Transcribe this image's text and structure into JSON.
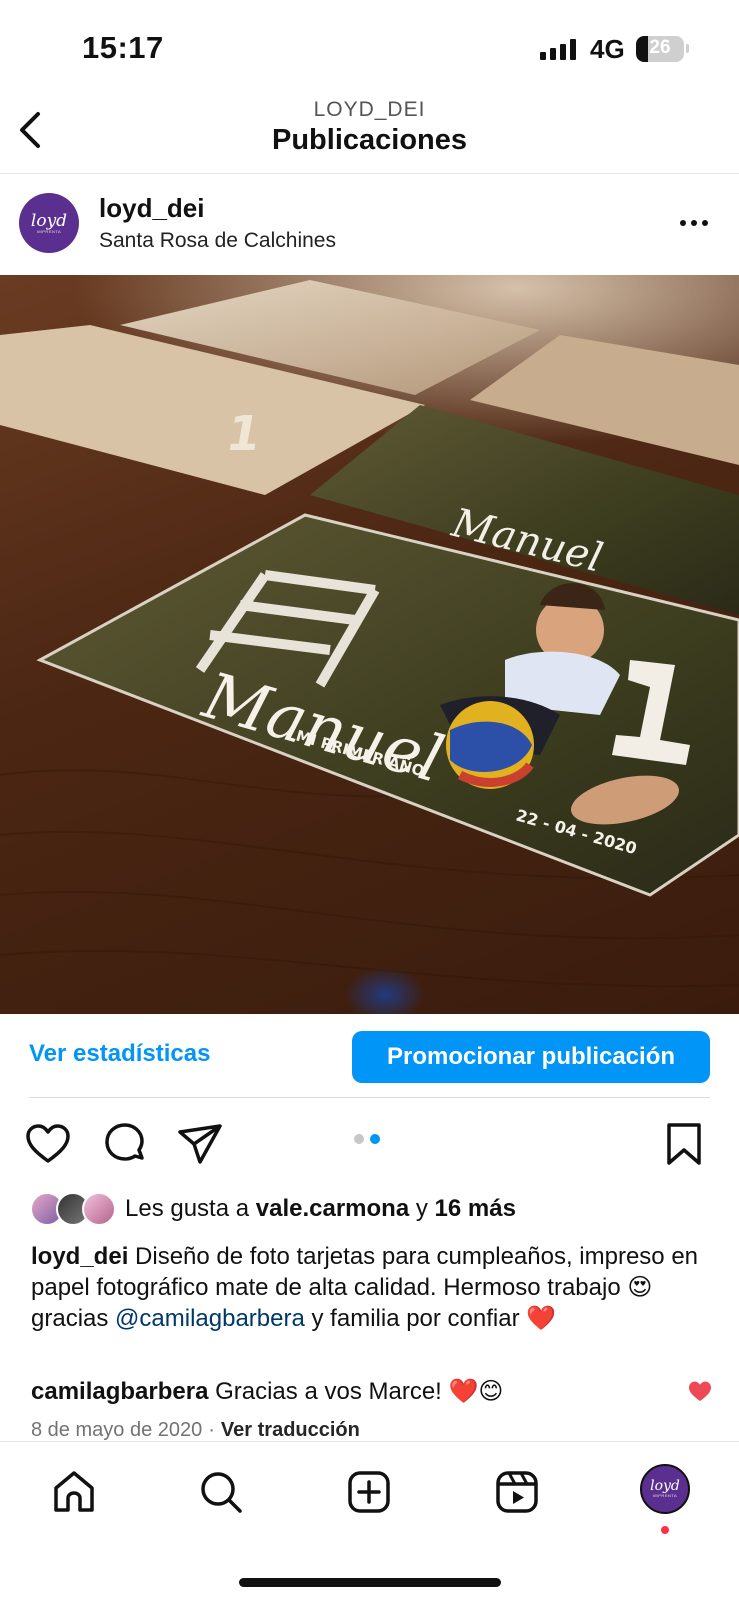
{
  "status_bar": {
    "time": "15:17",
    "network": "4G",
    "battery": "26",
    "battery_level": 0.26
  },
  "header": {
    "subtitle": "LOYD_DEI",
    "title": "Publicaciones"
  },
  "post": {
    "avatar_logo": "loyd",
    "avatar_sub": "IMPRENTA",
    "username": "loyd_dei",
    "location": "Santa Rosa de Calchines",
    "image_text": {
      "name": "Manuel",
      "tagline": "MI PRIMER AÑO",
      "date": "22 - 04 - 2020",
      "number": "1"
    },
    "stats_link": "Ver estadísticas",
    "promote_button": "Promocionar publicación",
    "carousel": {
      "count": 2,
      "active_index": 1
    },
    "likes": {
      "prefix": "Les gusta a",
      "user": "vale.carmona",
      "joiner": "y",
      "others": "16 más"
    },
    "caption": {
      "user": "loyd_dei",
      "text_1": "Diseño de foto tarjetas para cumpleaños, impreso en papel fotográfico mate de alta calidad. Hermoso trabajo",
      "emoji_1": "😍",
      "text_2": "gracias",
      "mention": "@camilagbarbera",
      "text_3": "y familia por confiar",
      "emoji_2": "❤️"
    },
    "comment": {
      "user": "camilagbarbera",
      "text": "Gracias a vos Marce!",
      "emoji": "❤️😊"
    },
    "date": "8 de mayo de 2020",
    "separator": "·",
    "translate": "Ver traducción"
  },
  "colors": {
    "accent": "#0095f6",
    "brand_purple": "#5b2f8f",
    "like_red": "#ed4956",
    "notification": "#ff3040"
  },
  "bottom_nav": {
    "items": [
      "home-icon",
      "search-icon",
      "create-icon",
      "reels-icon",
      "profile-avatar"
    ],
    "avatar_logo": "loyd",
    "avatar_sub": "IMPRENTA"
  }
}
